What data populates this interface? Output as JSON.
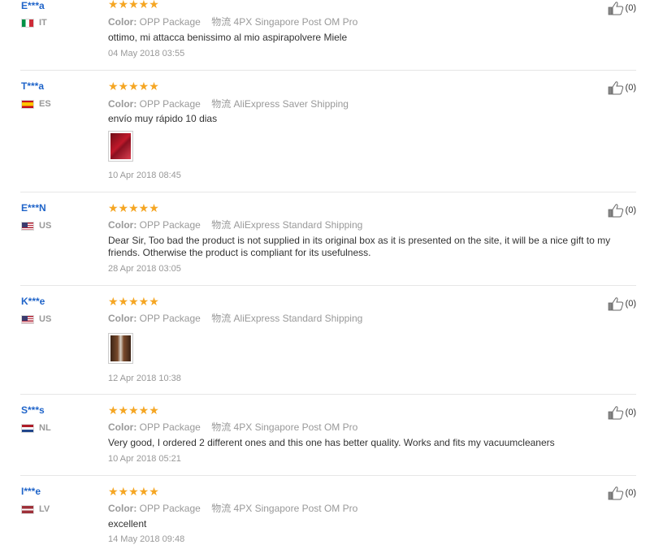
{
  "labels": {
    "color": "Color:",
    "shipping": "物流"
  },
  "reviews": [
    {
      "user": "E***a",
      "country": "IT",
      "flag": "it",
      "stars": "★★★★★",
      "color_value": "OPP Package",
      "shipping_value": "4PX Singapore Post OM Pro",
      "text": "ottimo, mi attacca benissimo al mio aspirapolvere Miele",
      "has_photo": false,
      "date": "04 May 2018 03:55",
      "helpful_count": "(0)"
    },
    {
      "user": "T***a",
      "country": "ES",
      "flag": "es",
      "stars": "★★★★★",
      "color_value": "OPP Package",
      "shipping_value": "AliExpress Saver Shipping",
      "text": "envío muy rápido 10 dias",
      "has_photo": true,
      "date": "10 Apr 2018 08:45",
      "helpful_count": "(0)"
    },
    {
      "user": "E***N",
      "country": "US",
      "flag": "us",
      "stars": "★★★★★",
      "color_value": "OPP Package",
      "shipping_value": "AliExpress Standard Shipping",
      "text": "Dear Sir, Too bad the product is not supplied in its original box as it is presented on the site, it will be a nice gift to my friends. Otherwise the product is compliant for its usefulness.",
      "has_photo": false,
      "date": "28 Apr 2018 03:05",
      "helpful_count": "(0)"
    },
    {
      "user": "K***e",
      "country": "US",
      "flag": "us",
      "stars": "★★★★★",
      "color_value": "OPP Package",
      "shipping_value": "AliExpress Standard Shipping",
      "text": "",
      "has_photo": true,
      "date": "12 Apr 2018 10:38",
      "helpful_count": "(0)"
    },
    {
      "user": "S***s",
      "country": "NL",
      "flag": "nl",
      "stars": "★★★★★",
      "color_value": "OPP Package",
      "shipping_value": "4PX Singapore Post OM Pro",
      "text": "Very good, I ordered 2 different ones and this one has better quality. Works and fits my vacuumcleaners",
      "has_photo": false,
      "date": "10 Apr 2018 05:21",
      "helpful_count": "(0)"
    },
    {
      "user": "I***e",
      "country": "LV",
      "flag": "lv",
      "stars": "★★★★★",
      "color_value": "OPP Package",
      "shipping_value": "4PX Singapore Post OM Pro",
      "text": "excellent",
      "has_photo": false,
      "date": "14 May 2018 09:48",
      "helpful_count": "(0)"
    }
  ],
  "colors": {
    "username": "#1f64c9",
    "stars": "#f5a623",
    "muted": "#999999",
    "divider": "#e6e6e6"
  },
  "icons": {
    "helpful": "thumbs-up-icon",
    "rating": "star-icon"
  }
}
